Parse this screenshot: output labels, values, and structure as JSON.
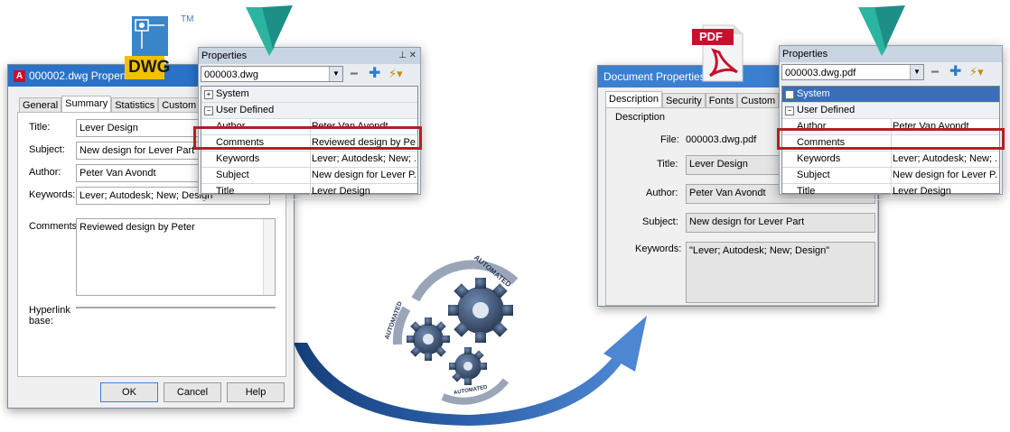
{
  "left_dialog": {
    "title": "000002.dwg Properties",
    "tabs": [
      "General",
      "Summary",
      "Statistics",
      "Custom"
    ],
    "fields": {
      "title_label": "Title:",
      "title_value": "Lever Design",
      "subject_label": "Subject:",
      "subject_value": "New design for Lever Part",
      "author_label": "Author:",
      "author_value": "Peter Van Avondt",
      "keywords_label": "Keywords:",
      "keywords_value": "Lever; Autodesk;  New; Design",
      "comments_label": "Comments:",
      "comments_value": "Reviewed design by Peter",
      "hyperlink_label": "Hyperlink base:",
      "hyperlink_value": ""
    },
    "buttons": {
      "ok": "OK",
      "cancel": "Cancel",
      "help": "Help"
    }
  },
  "dwg_logo": {
    "text": "DWG",
    "tm": "TM"
  },
  "left_palette": {
    "header": "Properties",
    "file": "000003.dwg",
    "categories": {
      "system": "System",
      "user_defined": "User Defined"
    },
    "rows": [
      {
        "key": "Author",
        "value": "Peter Van Avondt"
      },
      {
        "key": "Comments",
        "value": "Reviewed design by Pe..."
      },
      {
        "key": "Keywords",
        "value": "Lever; Autodesk;  New; ..."
      },
      {
        "key": "Subject",
        "value": "New design for Lever P..."
      },
      {
        "key": "Title",
        "value": "Lever Design"
      }
    ]
  },
  "automation": {
    "ring_text_top": "AUTOMATED",
    "ring_text_left": "AUTOMATED",
    "ring_text_bottom": "AUTOMATED"
  },
  "pdf_logo": {
    "text": "PDF"
  },
  "right_dialog": {
    "title": "Document Properties",
    "tabs": [
      "Description",
      "Security",
      "Fonts",
      "Custom"
    ],
    "section": "Description",
    "fields": {
      "file_label": "File:",
      "file_value": "000003.dwg.pdf",
      "title_label": "Title:",
      "title_value": "Lever Design",
      "author_label": "Author:",
      "author_value": "Peter Van Avondt",
      "subject_label": "Subject:",
      "subject_value": "New design for Lever Part",
      "keywords_label": "Keywords:",
      "keywords_value": "\"Lever; Autodesk;  New; Design\""
    }
  },
  "right_palette": {
    "header": "Properties",
    "file": "000003.dwg.pdf",
    "categories": {
      "system": "System",
      "user_defined": "User Defined"
    },
    "rows": [
      {
        "key": "Author",
        "value": "Peter Van Avondt"
      },
      {
        "key": "Comments",
        "value": ""
      },
      {
        "key": "Keywords",
        "value": "Lever; Autodesk;  New; ..."
      },
      {
        "key": "Subject",
        "value": "New design for Lever P..."
      },
      {
        "key": "Title",
        "value": "Lever Design"
      }
    ]
  },
  "colors": {
    "highlight": "#b11f24",
    "title_blue": "#2a72c8",
    "arrow_blue": "#2b5ea8",
    "autodesk_teal": "#1fa59a"
  }
}
